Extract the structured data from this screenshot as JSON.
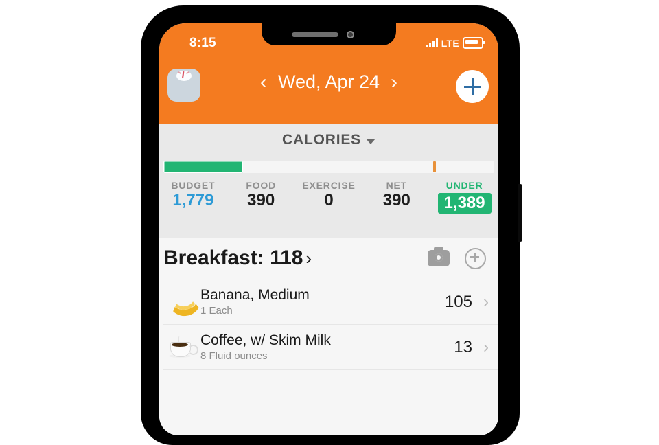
{
  "device": {
    "notch": {
      "speaker_name": "speaker-grille",
      "camera_name": "front-camera"
    }
  },
  "status_bar": {
    "time": "8:15",
    "carrier": "LTE",
    "signal_icon": "signal-bars-icon",
    "battery_icon": "battery-icon"
  },
  "nav": {
    "scale_icon": "weight-scale-icon",
    "prev_label": "‹",
    "date": "Wed, Apr 24",
    "next_label": "›",
    "add_icon": "plus-icon"
  },
  "calories": {
    "title": "CALORIES",
    "caret_icon": "chevron-down-icon",
    "progress": {
      "fill_percent": 24,
      "marker_percent": 82
    },
    "stats": [
      {
        "label": "BUDGET",
        "value": "1,779",
        "style": "budget"
      },
      {
        "label": "FOOD",
        "value": "390",
        "style": "normal"
      },
      {
        "label": "EXERCISE",
        "value": "0",
        "style": "normal"
      },
      {
        "label": "NET",
        "value": "390",
        "style": "normal"
      },
      {
        "label": "UNDER",
        "value": "1,389",
        "style": "under"
      }
    ]
  },
  "meal": {
    "title": "Breakfast: 118",
    "title_chevron": "›",
    "camera_icon": "camera-icon",
    "add_food_icon": "add-food-icon",
    "items": [
      {
        "icon": "banana-icon",
        "name": "Banana, Medium",
        "quantity": "1 Each",
        "calories": "105",
        "chevron": "›"
      },
      {
        "icon": "coffee-cup-icon",
        "name": "Coffee, w/ Skim Milk",
        "quantity": "8 Fluid ounces",
        "calories": "13",
        "chevron": "›"
      }
    ]
  },
  "colors": {
    "brand_orange": "#f47b20",
    "accent_green": "#22b573",
    "budget_blue": "#2e9bd6",
    "marker_orange": "#e8913a",
    "panel_gray": "#e9e9e9"
  }
}
